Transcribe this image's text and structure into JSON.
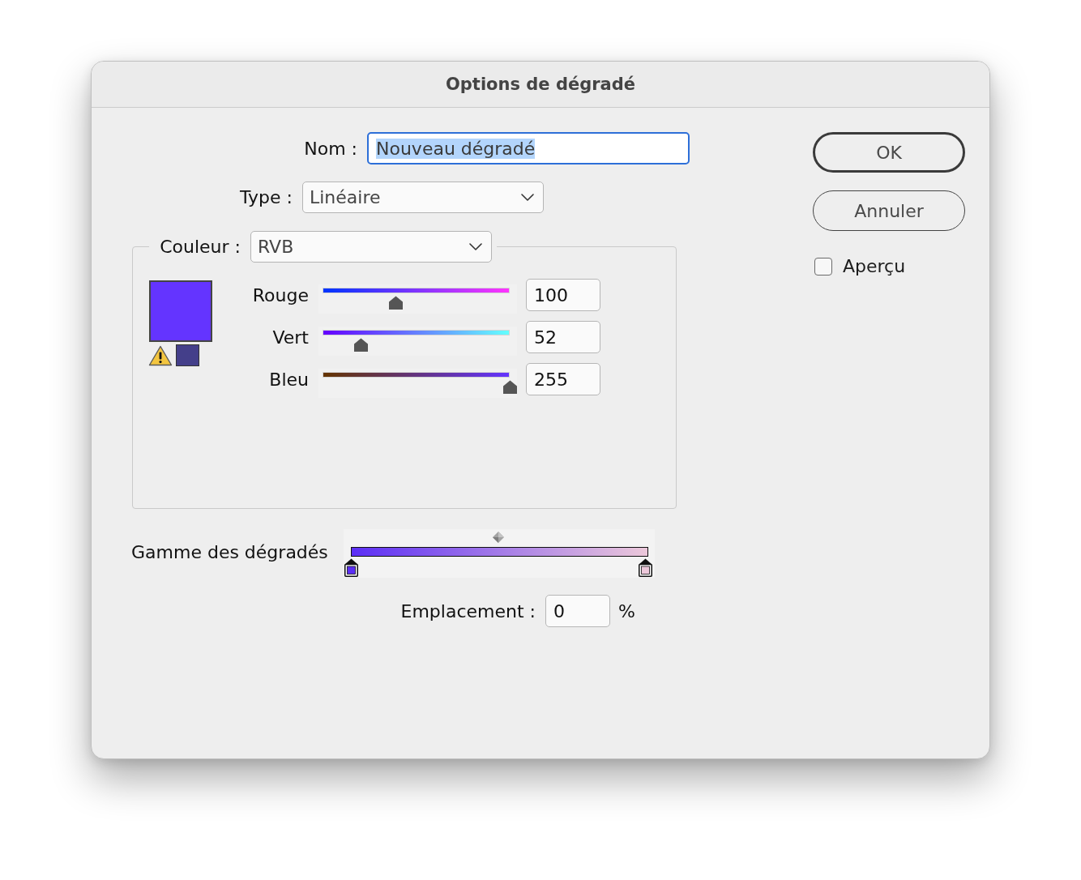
{
  "window": {
    "title": "Options de dégradé"
  },
  "name_field": {
    "label": "Nom :",
    "value": "Nouveau dégradé",
    "focused": true,
    "text_highlighted": true
  },
  "type_field": {
    "label": "Type :",
    "value": "Linéaire"
  },
  "color_group": {
    "label": "Couleur :",
    "model": "RVB",
    "gamut_warning": {
      "on": true,
      "color": "#443f8a"
    },
    "channels": [
      {
        "label": "Rouge",
        "level": 0.392,
        "reading": "100"
      },
      {
        "label": "Vert",
        "level": 0.204,
        "reading": "52"
      },
      {
        "label": "Bleu",
        "level": 1,
        "reading": "255"
      }
    ]
  },
  "gradient": {
    "label": "Gamme des dégradés",
    "stops": [
      {
        "level": 0,
        "color": "#5b2ef5"
      },
      {
        "level": 1,
        "color": "#ecc8da"
      }
    ]
  },
  "location": {
    "label": "Emplacement :",
    "value": "0",
    "unit": "%"
  },
  "buttons": [
    {
      "label": "OK",
      "default": true
    },
    {
      "label": "Annuler",
      "default": false
    }
  ],
  "preview": {
    "label": "Aperçu",
    "checked": false
  }
}
